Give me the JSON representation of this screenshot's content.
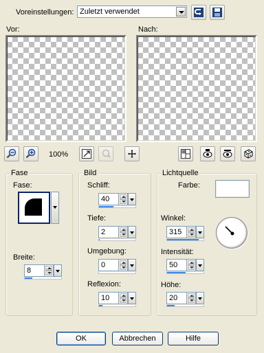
{
  "presets": {
    "label": "Voreinstellungen:",
    "value": "Zuletzt verwendet"
  },
  "preview": {
    "before_label": "Vor:",
    "after_label": "Nach:",
    "zoom": "100%"
  },
  "fase": {
    "group_title": "Fase",
    "label": "Fase:",
    "width_label": "Breite:",
    "width_value": "8",
    "width_fill": 0.2
  },
  "bild": {
    "group_title": "Bild",
    "schliff": {
      "label": "Schliff:",
      "value": "40",
      "fill": 0.4
    },
    "tiefe": {
      "label": "Tiefe:",
      "value": "2",
      "fill": 0.02
    },
    "umgebung": {
      "label": "Umgebung:",
      "value": "0",
      "fill": 0.0
    },
    "reflexion": {
      "label": "Reflexion:",
      "value": "10",
      "fill": 0.1
    }
  },
  "light": {
    "group_title": "Lichtquelle",
    "color_label": "Farbe:",
    "color": "#ffffff",
    "winkel": {
      "label": "Winkel:",
      "value": "315",
      "fill": 0.875
    },
    "intensitaet": {
      "label": "Intensität:",
      "value": "50",
      "fill": 0.5
    },
    "hoehe": {
      "label": "Höhe:",
      "value": "20",
      "fill": 0.2
    }
  },
  "buttons": {
    "ok": "OK",
    "cancel": "Abbrechen",
    "help": "Hilfe"
  },
  "icons": {
    "reset": "reset-arrow-icon",
    "save": "save-disk-icon",
    "zoom_out": "zoom-out-icon",
    "zoom_in": "zoom-in-icon",
    "fit": "fit-to-window-icon",
    "nav": "navigate-icon",
    "move": "pan-move-icon",
    "split_view": "split-view-icon",
    "proof": "proof-preview-icon",
    "auto_proof": "auto-proof-icon",
    "random": "randomize-dice-icon"
  },
  "colors": {
    "accent_fill": "#3c86e6",
    "dialog_bg": "#ece9d8"
  }
}
